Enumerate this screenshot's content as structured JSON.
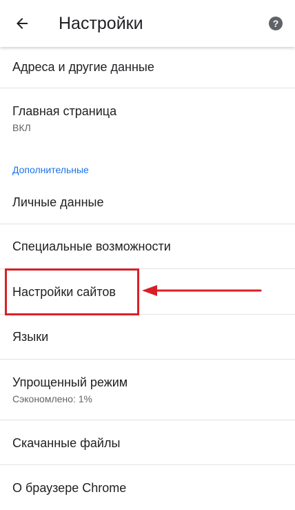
{
  "appbar": {
    "back_icon": "arrow-back-icon",
    "title": "Настройки",
    "help_icon": "help-icon",
    "help_glyph": "?"
  },
  "items": [
    {
      "label": "Адреса и другие данные"
    },
    {
      "label": "Главная страница",
      "subtitle": "ВКЛ"
    },
    {
      "label": "Личные данные"
    },
    {
      "label": "Специальные возможности"
    },
    {
      "label": "Настройки сайтов"
    },
    {
      "label": "Языки"
    },
    {
      "label": "Упрощенный режим",
      "subtitle": "Сэкономлено: 1%"
    },
    {
      "label": "Скачанные файлы"
    },
    {
      "label": "О браузере Chrome"
    }
  ],
  "section_header": "Дополнительные",
  "annotation": {
    "highlight_color": "#d81f26",
    "arrow_icon": "arrow-left-icon"
  },
  "colors": {
    "accent": "#1a73e8",
    "text_primary": "#202124",
    "text_secondary": "#5f6368",
    "divider": "#e2e2e2"
  }
}
